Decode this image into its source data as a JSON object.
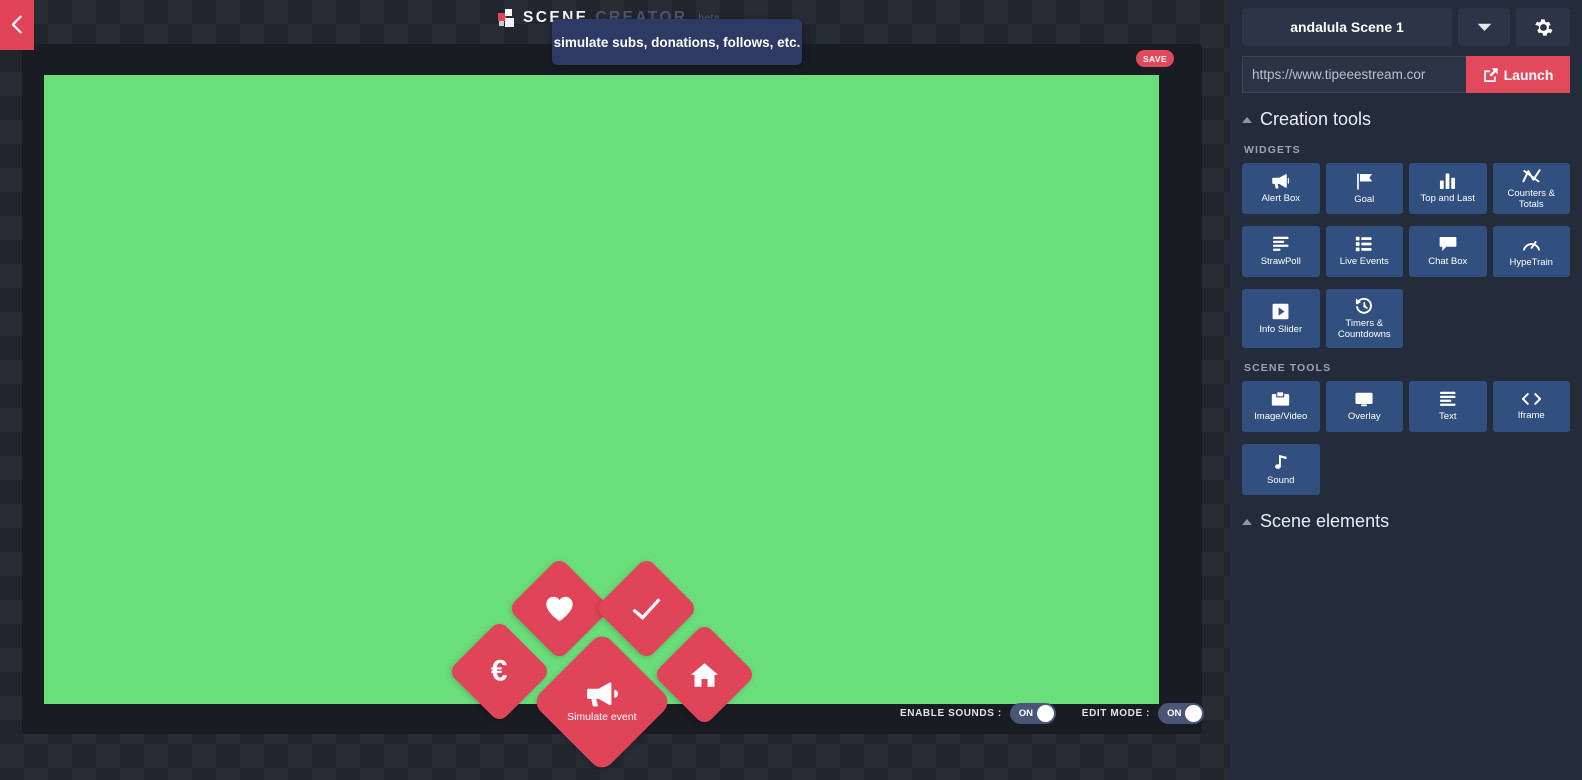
{
  "back_button": {
    "icon": "chevron-left-icon"
  },
  "logo": {
    "scene": "SCENE",
    "creator": "CREATOR",
    "beta": "beta"
  },
  "tooltip": {
    "text": "simulate subs, donations, follows, etc."
  },
  "save": {
    "label": "SAVE"
  },
  "canvas": {
    "background_color": "#6ade7a"
  },
  "simulate_buttons": [
    {
      "name": "follow",
      "icon": "heart-icon",
      "label": ""
    },
    {
      "name": "subscription",
      "icon": "check-icon",
      "label": ""
    },
    {
      "name": "donation",
      "icon": "euro-icon",
      "glyph": "€",
      "label": ""
    },
    {
      "name": "simulate-event",
      "icon": "megaphone-icon",
      "label": "Simulate event"
    },
    {
      "name": "host",
      "icon": "home-icon",
      "label": ""
    }
  ],
  "bottom_controls": [
    {
      "label": "ENABLE SOUNDS :",
      "value": "ON",
      "name": "enable-sounds"
    },
    {
      "label": "EDIT MODE :",
      "value": "ON",
      "name": "edit-mode"
    }
  ],
  "sidebar": {
    "scene_name": "andalula Scene 1",
    "dropdown_icon": "chevron-down-icon",
    "settings_icon": "gear-icon",
    "url_value": "https://www.tipeeestream.cor",
    "url_placeholder": "https://www.tipeeestream.com",
    "launch_label": "Launch",
    "launch_icon": "external-link-icon",
    "sections": [
      {
        "title": "Creation tools",
        "collapsed": false
      },
      {
        "title": "Scene elements",
        "collapsed": false
      }
    ],
    "widgets_heading": "WIDGETS",
    "widgets": [
      {
        "label": "Alert Box",
        "icon": "megaphone-icon"
      },
      {
        "label": "Goal",
        "icon": "flag-icon"
      },
      {
        "label": "Top and Last",
        "icon": "bar-chart-icon"
      },
      {
        "label": "Counters & Totals",
        "icon": "line-chart-icon"
      },
      {
        "label": "StrawPoll",
        "icon": "poll-icon"
      },
      {
        "label": "Live Events",
        "icon": "list-icon"
      },
      {
        "label": "Chat Box",
        "icon": "chat-bubble-icon"
      },
      {
        "label": "HypeTrain",
        "icon": "gauge-icon"
      },
      {
        "label": "Info Slider",
        "icon": "play-box-icon"
      },
      {
        "label": "Timers & Countdowns",
        "icon": "clock-back-icon"
      }
    ],
    "scene_tools_heading": "SCENE TOOLS",
    "scene_tools": [
      {
        "label": "Image/Video",
        "icon": "image-icon"
      },
      {
        "label": "Overlay",
        "icon": "monitor-icon"
      },
      {
        "label": "Text",
        "icon": "text-lines-icon"
      },
      {
        "label": "Iframe",
        "icon": "code-icon"
      },
      {
        "label": "Sound",
        "icon": "music-note-icon"
      }
    ]
  },
  "colors": {
    "accent_red": "#e3495c",
    "tile_blue": "#31507f",
    "sidebar_bg": "#242b3a",
    "canvas_green": "#6ade7a",
    "tooltip_bg": "#2e3a63"
  }
}
